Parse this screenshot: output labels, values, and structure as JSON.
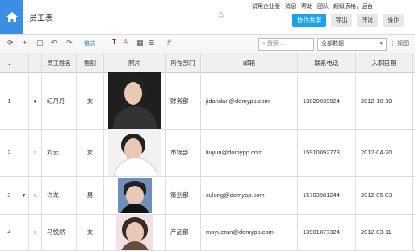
{
  "app": {
    "title": "员工表",
    "star_icon": "☆",
    "home_icon": "home-icon",
    "toplinks": [
      "试用企业版",
      "消息",
      "帮助",
      "团队",
      "超级表格，后台"
    ],
    "buttons": {
      "share": "协作共享",
      "export": "导出",
      "comment": "评论",
      "actions": "操作"
    }
  },
  "toolbar": {
    "format_label": "格式",
    "search_placeholder": "搜索...",
    "data_filter": "全部数据",
    "view_label": "视图"
  },
  "table": {
    "columns": [
      "员工姓名",
      "性别",
      "照片",
      "所在部门",
      "邮箱",
      "联系电话",
      "入职日期"
    ],
    "rows": [
      {
        "num": "1",
        "name": "纪丹丹",
        "gender": "女",
        "dept": "财务部",
        "email": "jidandan@domypp.com",
        "phone": "13820039024",
        "date": "2012-10-10"
      },
      {
        "num": "2",
        "name": "刘云",
        "gender": "女",
        "dept": "市场部",
        "email": "liuyun@domypp.com",
        "phone": "15910092773",
        "date": "2012-04-20"
      },
      {
        "num": "3",
        "name": "许龙",
        "gender": "男",
        "dept": "策划部",
        "email": "xulong@domypp.com",
        "phone": "15703981244",
        "date": "2012-05-03"
      },
      {
        "num": "4",
        "name": "马悦然",
        "gender": "女",
        "dept": "产品部",
        "email": "mayueran@domypp.com",
        "phone": "13901877324",
        "date": "2012-03-11"
      }
    ]
  }
}
